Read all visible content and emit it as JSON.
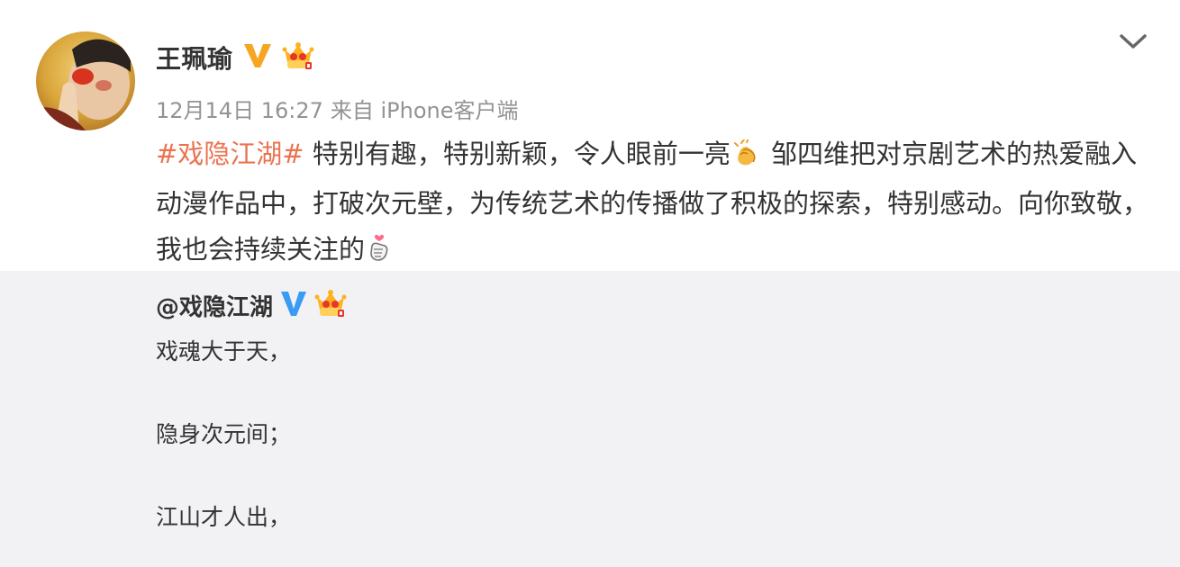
{
  "post": {
    "author": "王珮瑜",
    "time": "12月14日 16:27",
    "source": "来自 iPhone客户端",
    "topic": "#戏隐江湖#",
    "text_1": " 特别有趣，特别新颖，令人眼前一亮",
    "text_2": " 邹四维把对京剧艺术的热爱融入动漫作品中，打破次元壁，为传统艺术的传播做了积极的探索，特别感动。向你致敬，我也会持续关注的"
  },
  "repost": {
    "author": "@戏隐江湖",
    "lines": [
      "戏魂大于天，",
      "隐身次元间；",
      "江山才人出，"
    ]
  },
  "icons": {
    "verified_gold": "verified-v-gold-icon",
    "verified_blue": "verified-v-blue-icon",
    "vip_crown": "vip-crown-icon",
    "clap": "clapping-hands-emoji",
    "heart_hands": "finger-heart-emoji",
    "more": "chevron-down-icon"
  },
  "colors": {
    "topic": "#eb7350",
    "meta": "#939393",
    "repost_bg": "#f2f2f5",
    "verified_gold": "#f6a623",
    "verified_blue": "#3a9bf2"
  }
}
